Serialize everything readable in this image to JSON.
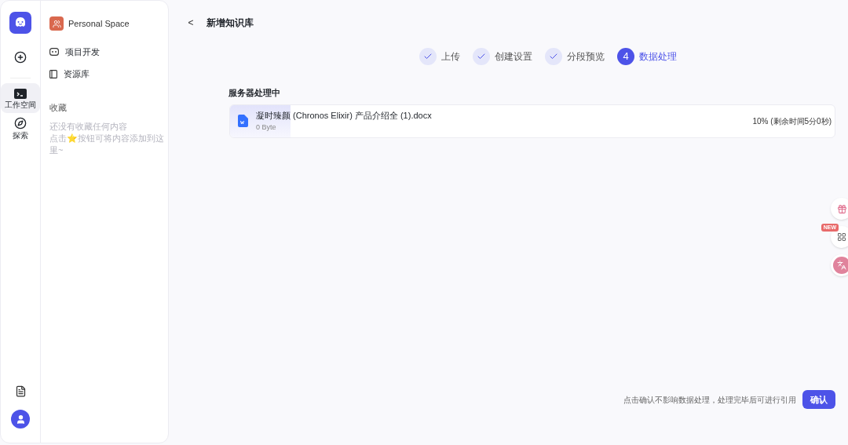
{
  "rail": {
    "items": [
      {
        "kind": "workspace",
        "label": "工作空间",
        "selected": true
      },
      {
        "kind": "explore",
        "label": "探索",
        "selected": false
      }
    ]
  },
  "space": {
    "title": "Personal Space",
    "nav": [
      {
        "kind": "project",
        "label": "项目开发"
      },
      {
        "kind": "library",
        "label": "资源库"
      }
    ],
    "favorites": {
      "title": "收藏",
      "empty": "还没有收藏任何内容",
      "hint": "点击⭐按钮可将内容添加到这里~"
    }
  },
  "header": {
    "back": "<",
    "title": "新增知识库"
  },
  "steps": [
    {
      "label": "上传",
      "done": true
    },
    {
      "label": "创建设置",
      "done": true
    },
    {
      "label": "分段预览",
      "done": true
    },
    {
      "number": "4",
      "label": "数据处理",
      "done": false
    }
  ],
  "section_title": "服务器处理中",
  "file": {
    "name": "凝时臻颜 (Chronos Elixir) 产品介绍全 (1).docx",
    "size": "0 Byte",
    "progress": "10% (剩余时间5分0秒)",
    "level": 0.1
  },
  "float_badge": "NEW",
  "footer": {
    "note": "点击确认不影响数据处理，处理完毕后可进行引用",
    "confirm": "确认"
  }
}
